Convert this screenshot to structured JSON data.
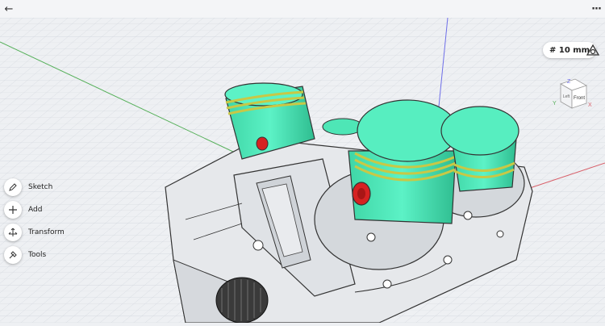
{
  "titlebar": {
    "back_icon": "arrow-left-icon",
    "menu_icon": "more-dots-icon",
    "menu_glyph": "···",
    "back_glyph": "←"
  },
  "viewport": {
    "grid_label": "# 10 mm",
    "camera_icon": "view-settings-icon",
    "viewcube": {
      "front": "Front",
      "left": "Left",
      "axis_x": "X",
      "axis_y": "Y",
      "axis_z": "Z"
    }
  },
  "toolbar": {
    "items": [
      {
        "label": "Sketch",
        "icon": "pen-icon"
      },
      {
        "label": "Add",
        "icon": "plus-icon"
      },
      {
        "label": "Transform",
        "icon": "transform-icon"
      },
      {
        "label": "Tools",
        "icon": "hammer-icon"
      }
    ]
  },
  "colors": {
    "piston": "#4ee6b6",
    "piston_ring": "#c8c846",
    "block": "#e4e6e9",
    "pin": "#d62222",
    "axis_green": "#56b05a",
    "axis_blue": "#6e6ee8",
    "axis_red": "#d8606a"
  }
}
